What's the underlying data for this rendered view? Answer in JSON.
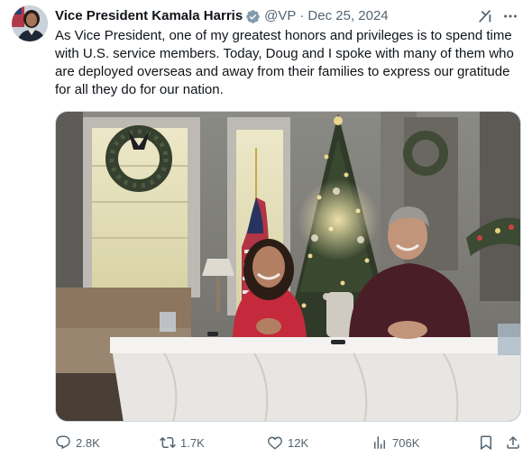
{
  "author": {
    "name": "Vice President Kamala Harris",
    "handle": "@VP",
    "separator": "·",
    "date": "Dec 25, 2024",
    "verified": true
  },
  "post_text": "As Vice President, one of my greatest honors and privileges is to spend time with U.S. service members. Today, Doug and I spoke with many of them who are deployed overseas and away from their families to express our gratitude for all they do for our nation.",
  "actions": {
    "replies": "2.8K",
    "reposts": "1.7K",
    "likes": "12K",
    "views": "706K"
  },
  "icons": {
    "header": [
      "verified-badge-icon",
      "grok-icon",
      "more-icon"
    ],
    "actions": [
      "reply-icon",
      "repost-icon",
      "like-icon",
      "views-icon",
      "bookmark-icon",
      "share-icon"
    ]
  },
  "colors": {
    "text": "#0f1419",
    "secondary": "#536471",
    "verified_badge": "#829aab",
    "border": "#cfd9de"
  }
}
